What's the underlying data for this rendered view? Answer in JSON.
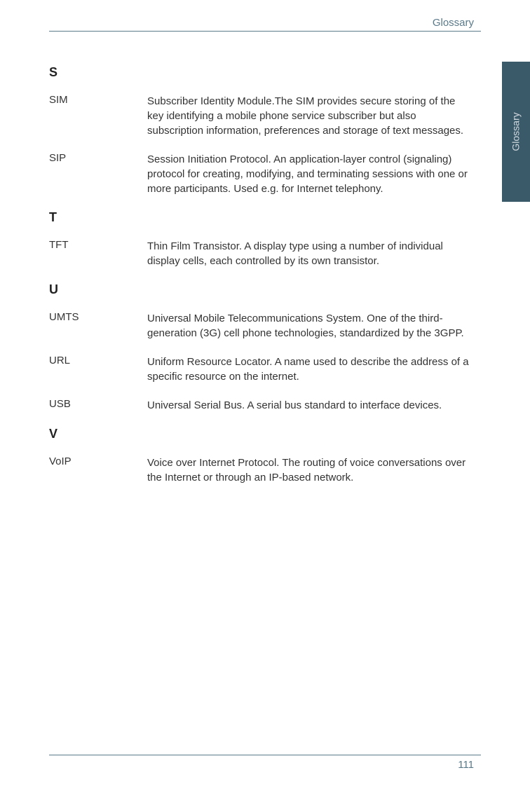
{
  "header": {
    "title": "Glossary"
  },
  "sideTab": {
    "label": "Glossary"
  },
  "sections": {
    "s": {
      "letter": "S",
      "entries": {
        "sim": {
          "term": "SIM",
          "definition": "Subscriber Identity Module.The SIM provides secure storing of the key identifying a mobile phone service subscriber but also subscription information, preferences and storage of text messages."
        },
        "sip": {
          "term": "SIP",
          "definition": "Session Initiation Protocol. An application-layer control (signaling) protocol for creating, modifying, and terminating sessions with one or more participants. Used e.g. for Internet telephony."
        }
      }
    },
    "t": {
      "letter": "T",
      "entries": {
        "tft": {
          "term": "TFT",
          "definition": "Thin Film Transistor. A display type using a number of individual display cells, each controlled by its own transistor."
        }
      }
    },
    "u": {
      "letter": "U",
      "entries": {
        "umts": {
          "term": "UMTS",
          "definition": "Universal Mobile Telecommunications System. One of the third-generation (3G) cell phone technologies, standardized by the 3GPP."
        },
        "url": {
          "term": "URL",
          "definition": "Uniform Resource Locator. A name used to describe the address of a specific resource on the internet."
        },
        "usb": {
          "term": "USB",
          "definition": "Universal Serial Bus. A serial bus standard to interface devices."
        }
      }
    },
    "v": {
      "letter": "V",
      "entries": {
        "voip": {
          "term": "VoIP",
          "definition": "Voice over Internet Protocol. The routing of voice conversations over the Internet or through an IP-based network."
        }
      }
    }
  },
  "footer": {
    "pageNumber": "111"
  }
}
